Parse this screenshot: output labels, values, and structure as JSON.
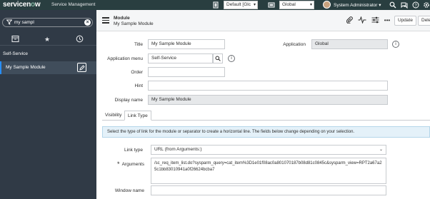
{
  "header": {
    "logo_prefix": "servicen",
    "logo_o": "o",
    "logo_suffix": "w",
    "product": "Service Management",
    "update_set": "Default [Glc",
    "application_scope": "Global",
    "user_name": "System Administrator",
    "icons": [
      "caret-down-icon",
      "search-icon",
      "chat-icon",
      "help-icon",
      "gear-icon"
    ]
  },
  "nav": {
    "filter_value": "my sampl",
    "group": "Self-Service",
    "item": "My Sample Module"
  },
  "form_header": {
    "record_type": "Module",
    "record_name": "My Sample Module",
    "update_label": "Update",
    "delete_label": "Delet"
  },
  "form": {
    "title_label": "Title",
    "title_value": "My Sample Module",
    "application_label": "Application",
    "application_value": "Global",
    "app_menu_label": "Application menu",
    "app_menu_value": "Self-Service",
    "order_label": "Order",
    "order_value": "",
    "hint_label": "Hint",
    "hint_value": "",
    "display_name_label": "Display name",
    "display_name_value": "My Sample Module"
  },
  "tabs": [
    {
      "label": "Visibility"
    },
    {
      "label": "Link Type"
    }
  ],
  "link_type": {
    "info": "Select the type of link for the module or separator to create a horizontal line. The fields below change depending on your selection.",
    "link_type_label": "Link type",
    "link_type_value": "URL (from Arguments:)",
    "required_mark": "*",
    "arguments_label": "Arguments",
    "arguments_value": "/sc_req_item_list.do?sysparm_query=cat_item%3D1e01f08ac0a801070187b08d81c0845c&sysparm_view=RPT2a67a25c1bb83010941a0f26624bcba7",
    "window_name_label": "Window name",
    "window_name_value": ""
  },
  "colors": {
    "header_bg": "#293e40",
    "nav_bg": "#303a46",
    "accent": "#278efc",
    "info_bg": "#e4f1f9"
  }
}
